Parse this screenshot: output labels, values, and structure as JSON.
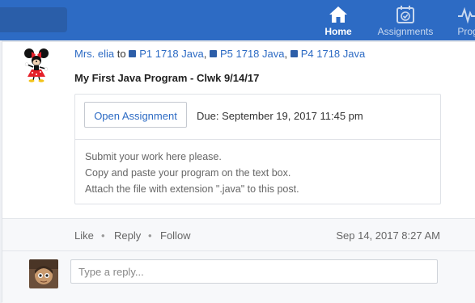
{
  "nav": {
    "items": [
      {
        "label": "Home",
        "icon": "home-icon",
        "active": true
      },
      {
        "label": "Assignments",
        "icon": "calendar-check-icon",
        "active": false
      },
      {
        "label": "Prog",
        "icon": "progress-icon",
        "active": false
      }
    ]
  },
  "post": {
    "author": "Mrs. elia",
    "to_word": "to",
    "groups": [
      "P1 1718 Java",
      "P5 1718 Java",
      "P4 1718 Java"
    ],
    "title": "My First Java Program - Clwk 9/14/17",
    "assignment": {
      "button_label": "Open Assignment",
      "due": "Due: September 19, 2017 11:45 pm",
      "body_lines": [
        "Submit your work here please.",
        "Copy and paste your program on the text box.",
        "Attach the file with extension \".java\" to this post."
      ]
    },
    "actions": [
      "Like",
      "Reply",
      "Follow"
    ],
    "separator": "•",
    "timestamp": "Sep 14, 2017 8:27 AM"
  },
  "reply": {
    "placeholder": "Type a reply..."
  },
  "colors": {
    "brand": "#2d6bc4",
    "group_square": "#2d5ea8"
  }
}
